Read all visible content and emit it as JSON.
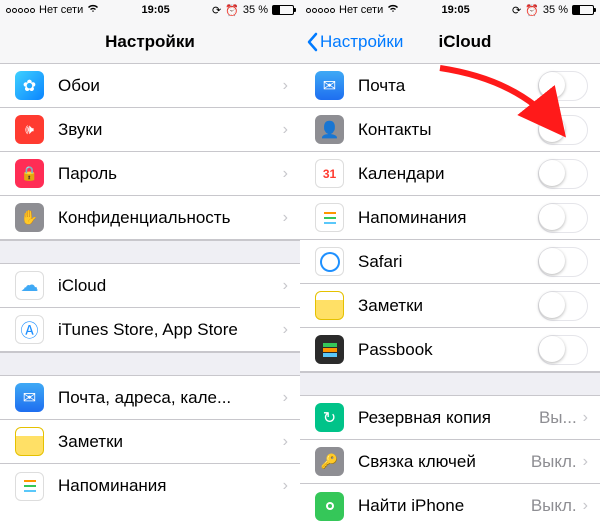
{
  "status": {
    "carrier": "Нет сети",
    "time": "19:05",
    "battery_pct": "35 %"
  },
  "left": {
    "title": "Настройки",
    "rows": [
      {
        "name": "wallpaper",
        "label": "Обои"
      },
      {
        "name": "sounds",
        "label": "Звуки"
      },
      {
        "name": "passcode",
        "label": "Пароль"
      },
      {
        "name": "privacy",
        "label": "Конфиденциальность"
      }
    ],
    "rows2": [
      {
        "name": "icloud",
        "label": "iCloud"
      },
      {
        "name": "itunes",
        "label": "iTunes Store, App Store"
      }
    ],
    "rows3": [
      {
        "name": "mailcal",
        "label": "Почта, адреса, кале..."
      },
      {
        "name": "notes",
        "label": "Заметки"
      },
      {
        "name": "reminders",
        "label": "Напоминания"
      }
    ]
  },
  "right": {
    "back": "Настройки",
    "title": "iCloud",
    "items": [
      {
        "name": "mail",
        "label": "Почта"
      },
      {
        "name": "contacts",
        "label": "Контакты"
      },
      {
        "name": "calendars",
        "label": "Календари"
      },
      {
        "name": "reminders",
        "label": "Напоминания"
      },
      {
        "name": "safari",
        "label": "Safari"
      },
      {
        "name": "notes",
        "label": "Заметки"
      },
      {
        "name": "passbook",
        "label": "Passbook"
      }
    ],
    "detail_rows": [
      {
        "name": "backup",
        "label": "Резервная копия",
        "detail": "Вы..."
      },
      {
        "name": "keychain",
        "label": "Связка ключей",
        "detail": "Выкл."
      },
      {
        "name": "findphone",
        "label": "Найти iPhone",
        "detail": "Выкл."
      }
    ]
  },
  "icon_glyphs": {
    "wallpaper": "✿",
    "sounds": "🔊",
    "passcode": "🔒",
    "privacy": "✋",
    "icloud": "☁",
    "itunes": "Ⓐ",
    "mail": "✉",
    "contacts": "👤",
    "calendar": "31",
    "reminders": "≡",
    "safari": "◉",
    "notes": "≣",
    "passbook": "▤",
    "backup": "↻",
    "keychain": "🔑",
    "findphone": "◎"
  }
}
